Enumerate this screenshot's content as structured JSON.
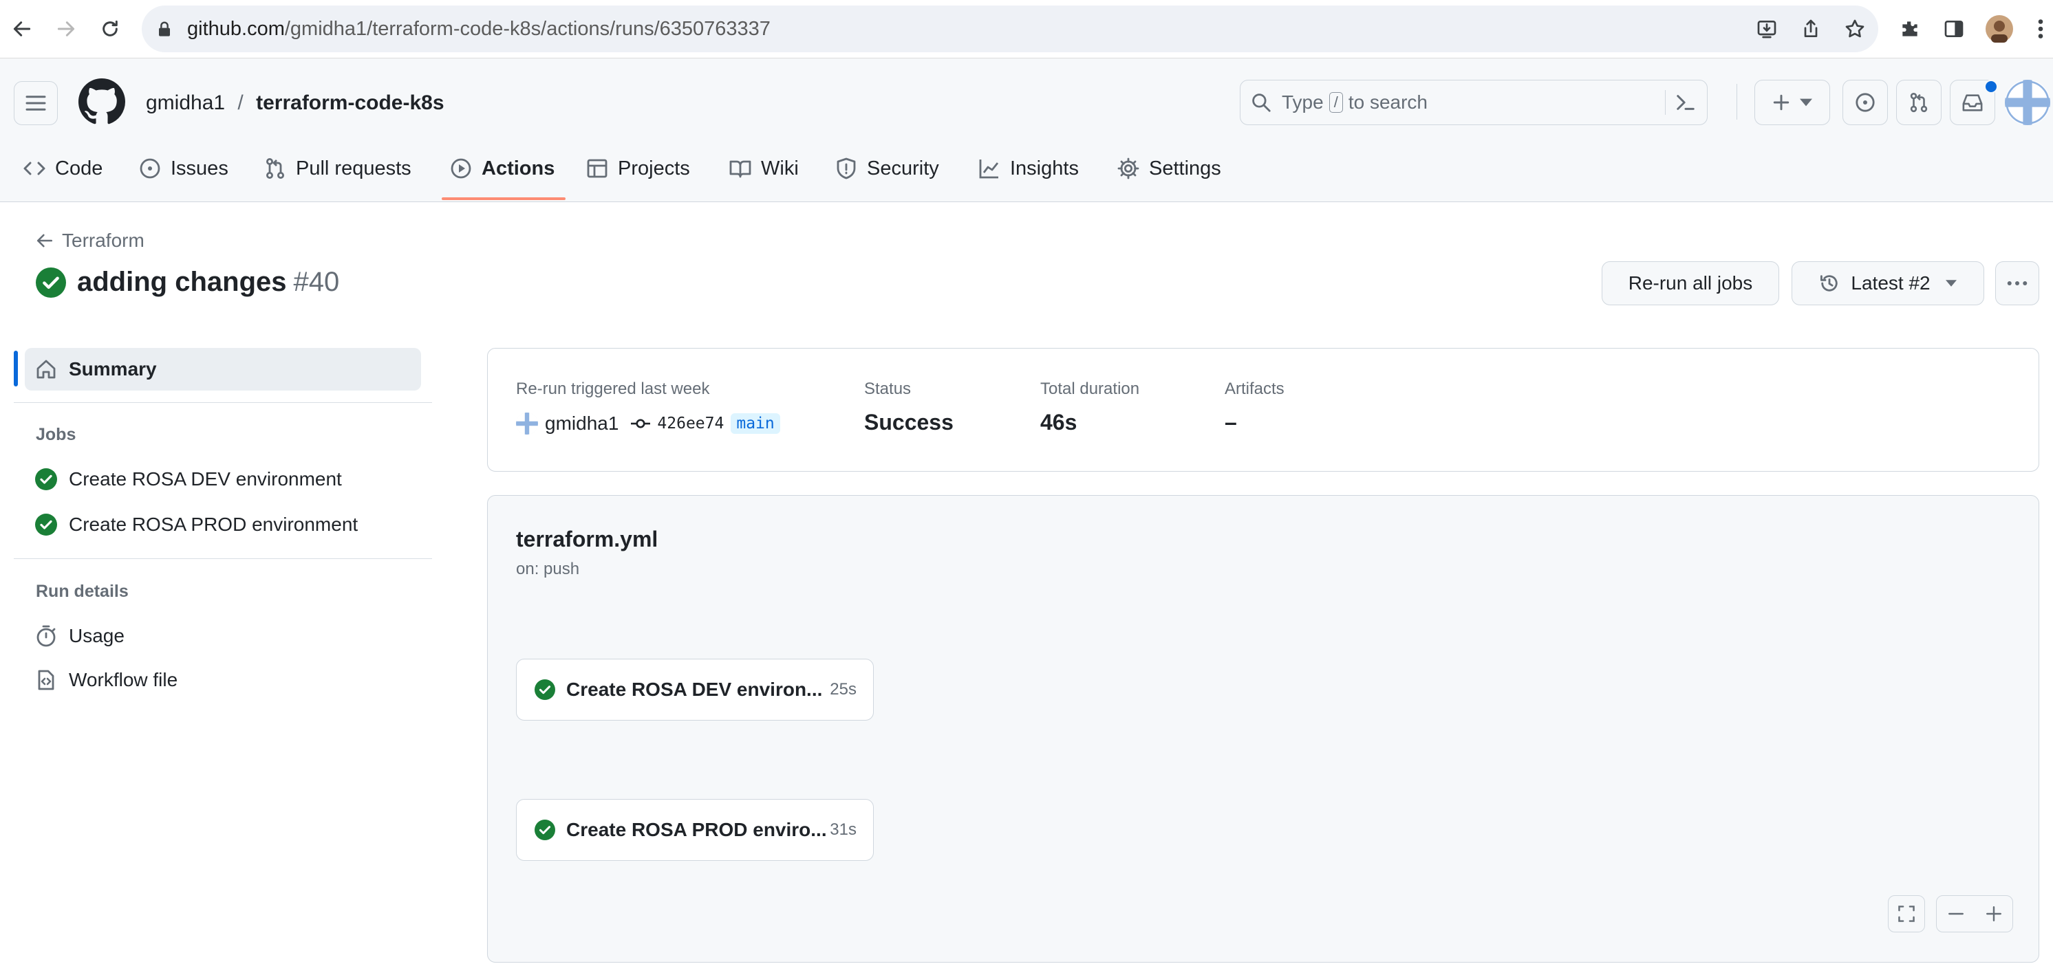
{
  "browser": {
    "url_host": "github.com",
    "url_path": "/gmidha1/terraform-code-k8s/actions/runs/6350763337"
  },
  "header": {
    "owner": "gmidha1",
    "separator": "/",
    "repo": "terraform-code-k8s",
    "search_placeholder_pre": "Type",
    "search_key": "/",
    "search_placeholder_post": "to search"
  },
  "tabs": [
    {
      "label": "Code",
      "icon": "code-icon"
    },
    {
      "label": "Issues",
      "icon": "issue-icon"
    },
    {
      "label": "Pull requests",
      "icon": "pull-request-icon"
    },
    {
      "label": "Actions",
      "icon": "play-icon",
      "active": true
    },
    {
      "label": "Projects",
      "icon": "table-icon"
    },
    {
      "label": "Wiki",
      "icon": "book-icon"
    },
    {
      "label": "Security",
      "icon": "shield-icon"
    },
    {
      "label": "Insights",
      "icon": "graph-icon"
    },
    {
      "label": "Settings",
      "icon": "gear-icon"
    }
  ],
  "run": {
    "back_label": "Terraform",
    "title": "adding changes",
    "number": "#40",
    "rerun_label": "Re-run all jobs",
    "attempt_label": "Latest #2"
  },
  "sidebar": {
    "summary_label": "Summary",
    "jobs_heading": "Jobs",
    "jobs": [
      "Create ROSA DEV environment",
      "Create ROSA PROD environment"
    ],
    "details_heading": "Run details",
    "usage_label": "Usage",
    "workflow_file_label": "Workflow file"
  },
  "summary": {
    "trigger_label": "Re-run triggered last week",
    "actor": "gmidha1",
    "commit": "426ee74",
    "branch": "main",
    "status_label": "Status",
    "status_value": "Success",
    "duration_label": "Total duration",
    "duration_value": "46s",
    "artifacts_label": "Artifacts",
    "artifacts_value": "–"
  },
  "workflow": {
    "file": "terraform.yml",
    "event": "on: push",
    "jobs": [
      {
        "name": "Create ROSA DEV environ...",
        "duration": "25s"
      },
      {
        "name": "Create ROSA PROD enviro...",
        "duration": "31s"
      }
    ]
  },
  "colors": {
    "success": "#1a7f37",
    "accent_underline": "#fd8c73",
    "selected_bar": "#0969da"
  }
}
